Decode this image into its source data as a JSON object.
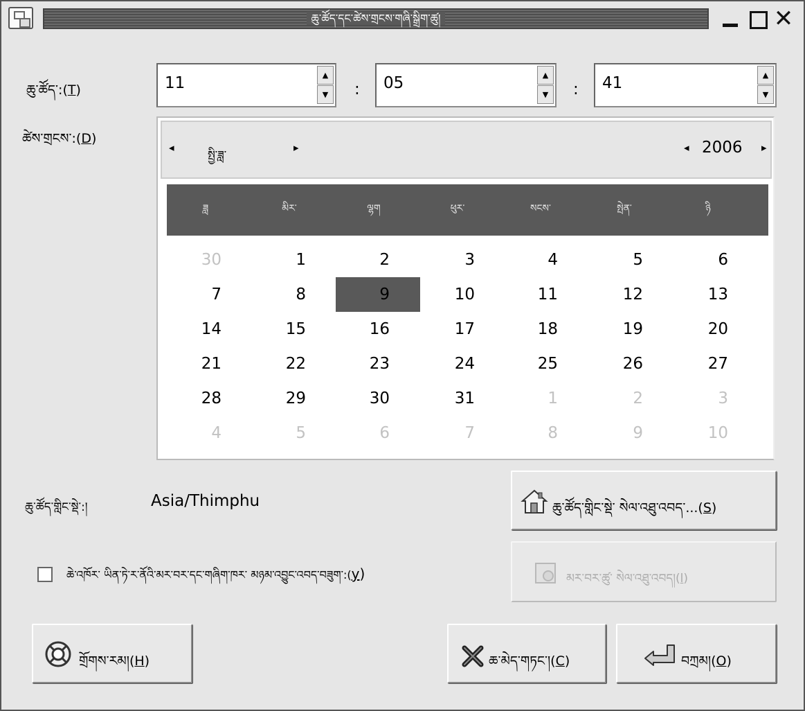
{
  "window": {
    "title": "ཆུ་ཚོད་དང་ཚེས་གྲངས་གཞི་སྒྲིག་ཚུ།",
    "controls": {
      "minimize": "_",
      "maximize": "□",
      "close": "✕"
    }
  },
  "time": {
    "label_text": "ཆུ་ཚོད་:(",
    "label_key": "T",
    "label_end": ")",
    "hour": "11",
    "minute": "05",
    "second": "41",
    "separator": ":"
  },
  "date": {
    "label_text": "ཚེས་གྲངས་:(",
    "label_key": "D",
    "label_end": ")"
  },
  "calendar": {
    "month": "སྤྱི་ཟླ་",
    "year": "2006",
    "prev_arrow": "◂",
    "next_arrow": "▸",
    "day_names": [
      "ཟླ",
      "མིར་",
      "ལྷག",
      "ཕུར་",
      "སངས་",
      "སྤེན་",
      "ཉི"
    ],
    "weeks": [
      [
        "30",
        "1",
        "2",
        "3",
        "4",
        "5",
        "6"
      ],
      [
        "7",
        "8",
        "9",
        "10",
        "11",
        "12",
        "13"
      ],
      [
        "14",
        "15",
        "16",
        "17",
        "18",
        "19",
        "20"
      ],
      [
        "21",
        "22",
        "23",
        "24",
        "25",
        "26",
        "27"
      ],
      [
        "28",
        "29",
        "30",
        "31",
        "1",
        "2",
        "3"
      ],
      [
        "4",
        "5",
        "6",
        "7",
        "8",
        "9",
        "10"
      ]
    ],
    "selected_day": "9"
  },
  "timezone": {
    "label": "ཆུ་ཚོད་གླིང་སྡེ་:།",
    "value": "Asia/Thimphu",
    "select_button_text": "ཆུ་ཚོད་གླིང་སྡེ་ སེལ་འཐུ་འབད་...(",
    "select_button_key": "S",
    "select_button_end": ")"
  },
  "sync": {
    "checkbox_label_text": "ཆེ་འཁོར་ ཡིན་ཏེ་ར་ནོའི་མར་བར་དང་གཞིག་ཁར་ མཉམ་འབྱུང་འབད་བཟུག་:(",
    "checkbox_label_key": "y",
    "checkbox_label_end": ")",
    "checked": false,
    "servers_button_text": "མར་བར་ཚུ་ སེལ་འཐུ་འབད།(",
    "servers_button_key": "l",
    "servers_button_end": ")"
  },
  "buttons": {
    "help_text": "གྲོགས་རམ།(",
    "help_key": "H",
    "help_end": ")",
    "cancel_text": "ཆ་མེད་གཏང་།(",
    "cancel_key": "C",
    "cancel_end": ")",
    "ok_text": "བཀྲམ།(",
    "ok_key": "O",
    "ok_end": ")"
  },
  "icons": {
    "window": "window-icon",
    "timezone": "home-icon",
    "servers": "server-icon",
    "help": "lifebuoy-icon",
    "cancel": "cancel-x-icon",
    "ok": "ok-arrow-icon"
  }
}
